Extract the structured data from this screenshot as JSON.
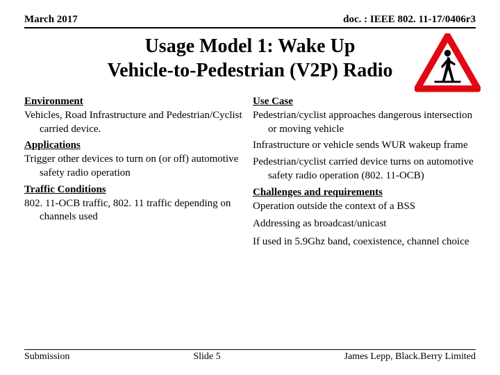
{
  "header": {
    "date": "March 2017",
    "docref": "doc. : IEEE 802. 11-17/0406r3"
  },
  "title_line1": "Usage Model 1: Wake Up",
  "title_line2": "Vehicle-to-Pedestrian (V2P) Radio",
  "left": {
    "env_head": "Environment",
    "env_body": "Vehicles, Road Infrastructure and Pedestrian/Cyclist carried device.",
    "app_head": "Applications",
    "app_body": "Trigger other devices to turn on (or off) automotive safety radio operation",
    "traf_head": "Traffic Conditions",
    "traf_body": "802. 11-OCB traffic, 802. 11 traffic depending on channels used"
  },
  "right": {
    "uc_head": "Use Case",
    "uc_1": "Pedestrian/cyclist approaches dangerous intersection or moving vehicle",
    "uc_2": "Infrastructure or vehicle sends WUR wakeup frame",
    "uc_3": "Pedestrian/cyclist carried device turns on automotive safety radio operation (802. 11-OCB)",
    "ch_head": "Challenges and requirements",
    "ch_1": "Operation outside the context of a BSS",
    "ch_2": "Addressing as broadcast/unicast",
    "ch_3": "If used in 5.9Ghz band, coexistence, channel choice"
  },
  "footer": {
    "left": "Submission",
    "center": "Slide 5",
    "right": "James Lepp, Black.Berry Limited"
  }
}
